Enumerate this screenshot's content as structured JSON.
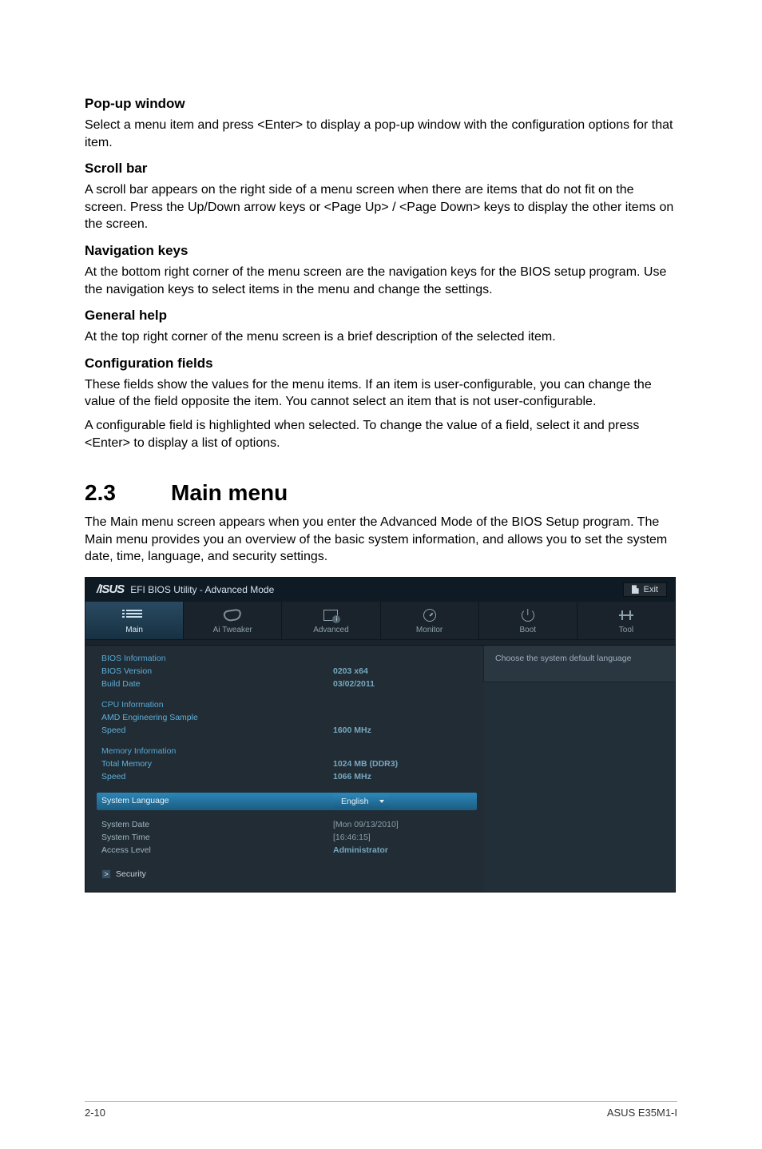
{
  "sections": {
    "popup": {
      "heading": "Pop-up window",
      "p1": "Select a menu item and press <Enter> to display a pop-up window with the configuration options for that item."
    },
    "scrollbar": {
      "heading": "Scroll bar",
      "p1": "A scroll bar appears on the right side of a menu screen when there are items that do not fit on the screen. Press the Up/Down arrow keys or <Page Up> / <Page Down> keys to display the other items on the screen."
    },
    "navkeys": {
      "heading": "Navigation keys",
      "p1": "At the bottom right corner of the menu screen are the navigation keys for the BIOS setup program. Use the navigation keys to select items in the menu and change the settings."
    },
    "genhelp": {
      "heading": "General help",
      "p1": "At the top right corner of the menu screen is a brief description of the selected item."
    },
    "cfgfields": {
      "heading": "Configuration fields",
      "p1": "These fields show the values for the menu items. If an item is user-configurable, you can change the value of the field opposite the item. You cannot select an item that is not user-configurable.",
      "p2": "A configurable field is highlighted when selected. To change the value of a field, select it and press <Enter> to display a list of options."
    }
  },
  "main": {
    "num": "2.3",
    "title": "Main menu",
    "intro": "The Main menu screen appears when you enter the Advanced Mode of the BIOS Setup program. The Main menu provides you an overview of the basic system information, and allows you to set the system date, time, language, and security settings."
  },
  "bios": {
    "brand": "/ISUS",
    "header_title": "EFI BIOS Utility - Advanced Mode",
    "exit_label": "Exit",
    "tabs": {
      "main": "Main",
      "ai_tweaker": "Ai  Tweaker",
      "advanced": "Advanced",
      "monitor": "Monitor",
      "boot": "Boot",
      "tool": "Tool"
    },
    "help_text": "Choose the system default language",
    "groups": {
      "bios_info": {
        "title": "BIOS Information",
        "rows": {
          "version_k": "BIOS Version",
          "version_v": "0203 x64",
          "build_k": "Build Date",
          "build_v": "03/02/2011"
        }
      },
      "cpu_info": {
        "title": "CPU Information",
        "rows": {
          "sample_k": "AMD Engineering Sample",
          "speed_k": "Speed",
          "speed_v": "1600 MHz"
        }
      },
      "mem_info": {
        "title": "Memory Information",
        "rows": {
          "total_k": "Total Memory",
          "total_v": "1024 MB (DDR3)",
          "speed_k": "Speed",
          "speed_v": "1066 MHz"
        }
      },
      "lang": {
        "label": "System Language",
        "value": "English"
      },
      "datetime": {
        "date_k": "System Date",
        "date_v": "[Mon 09/13/2010]",
        "time_k": "System Time",
        "time_v": "[16:46:15]",
        "access_k": "Access Level",
        "access_v": "Administrator"
      },
      "security": "Security"
    }
  },
  "footer": {
    "left": "2-10",
    "right": "ASUS E35M1-I"
  }
}
